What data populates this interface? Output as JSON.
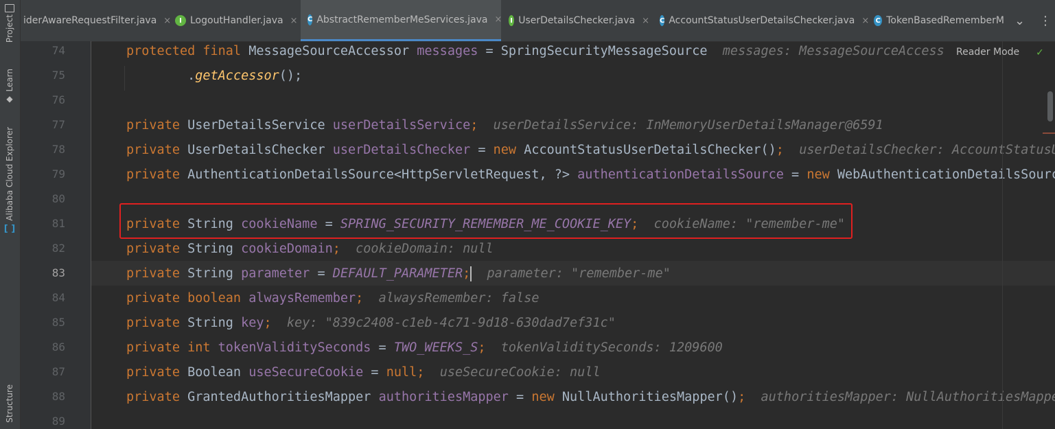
{
  "sidebar": {
    "project": "Project",
    "learn": "Learn",
    "alibaba": "Alibaba Cloud Explorer",
    "structure": "Structure"
  },
  "tabs": [
    {
      "label": "iderAwareRequestFilter.java",
      "icon": "",
      "active": false
    },
    {
      "label": "LogoutHandler.java",
      "icon": "I",
      "active": false
    },
    {
      "label": "AbstractRememberMeServices.java",
      "icon": "C",
      "active": true
    },
    {
      "label": "UserDetailsChecker.java",
      "icon": "I",
      "active": false
    },
    {
      "label": "AccountStatusUserDetailsChecker.java",
      "icon": "C",
      "active": false
    },
    {
      "label": "TokenBasedRememberM",
      "icon": "C",
      "active": false
    }
  ],
  "tab_close": "×",
  "tab_menu": "⌄",
  "tab_more": "⋮",
  "reader_mode": "Reader Mode",
  "line_numbers": [
    "74",
    "75",
    "76",
    "77",
    "78",
    "79",
    "80",
    "81",
    "82",
    "83",
    "84",
    "85",
    "86",
    "87",
    "88",
    "89"
  ],
  "current_line": "83",
  "code": {
    "l74": {
      "kw": "protected final ",
      "type": "MessageSourceAccessor ",
      "field": "messages",
      "rest": " = SpringSecurityMessageSource",
      "hint": "messages: MessageSourceAccess"
    },
    "l75": {
      "rest1": "        .",
      "method": "getAccessor",
      "rest2": "();"
    },
    "l77": {
      "kw": "private ",
      "type": "UserDetailsService ",
      "field": "userDetailsService",
      "semi": ";",
      "hint": "userDetailsService: InMemoryUserDetailsManager@6591"
    },
    "l78": {
      "kw": "private ",
      "type": "UserDetailsChecker ",
      "field": "userDetailsChecker",
      "eq": " = ",
      "kw2": "new ",
      "rest": "AccountStatusUserDetailsChecker()",
      "semi": ";",
      "hint": "userDetailsChecker: AccountStatusUs"
    },
    "l79": {
      "kw": "private ",
      "type": "AuthenticationDetailsSource<HttpServletRequest, ?> ",
      "field": "authenticationDetailsSource",
      "eq": " = ",
      "kw2": "new ",
      "rest": "WebAuthenticationDetailsSource"
    },
    "l81": {
      "kw": "private ",
      "type": "String ",
      "field": "cookieName",
      "eq": " = ",
      "const": "SPRING_SECURITY_REMEMBER_ME_COOKIE_KEY",
      "semi": ";",
      "hint": "cookieName: \"remember-me\""
    },
    "l82": {
      "kw": "private ",
      "type": "String ",
      "field": "cookieDomain",
      "semi": ";",
      "hint": "cookieDomain: null"
    },
    "l83": {
      "kw": "private ",
      "type": "String ",
      "field": "parameter",
      "eq": " = ",
      "const": "DEFAULT_PARAMETER",
      "semi": ";",
      "hint": "parameter: \"remember-me\""
    },
    "l84": {
      "kw": "private boolean ",
      "field": "alwaysRemember",
      "semi": ";",
      "hint": "alwaysRemember: false"
    },
    "l85": {
      "kw": "private ",
      "type": "String ",
      "field": "key",
      "semi": ";",
      "hint": "key: \"839c2408-c1eb-4c71-9d18-630dad7ef31c\""
    },
    "l86": {
      "kw": "private int ",
      "field": "tokenValiditySeconds",
      "eq": " = ",
      "const": "TWO_WEEKS_S",
      "semi": ";",
      "hint": "tokenValiditySeconds: 1209600"
    },
    "l87": {
      "kw": "private ",
      "type": "Boolean ",
      "field": "useSecureCookie",
      "eq": " = ",
      "kw2": "null",
      "semi": ";",
      "hint": "useSecureCookie: null"
    },
    "l88": {
      "kw": "private ",
      "type": "GrantedAuthoritiesMapper ",
      "field": "authoritiesMapper",
      "eq": " = ",
      "kw2": "new ",
      "rest": "NullAuthoritiesMapper()",
      "semi": ";",
      "hint": "authoritiesMapper: NullAuthoritiesMapper"
    }
  },
  "colors": {
    "keyword": "#cc7832",
    "field": "#9876aa",
    "default": "#a9b7c6",
    "hint": "#787878",
    "highlight_box": "#e02020",
    "active_tab_underline": "#4a88c7"
  }
}
